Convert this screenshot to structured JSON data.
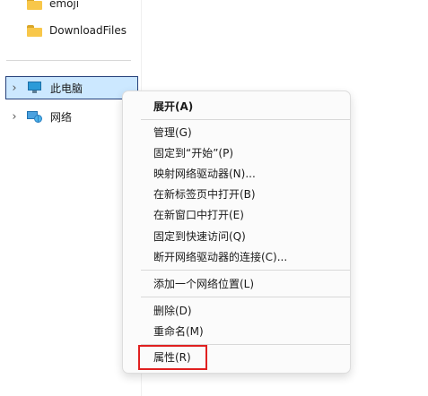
{
  "sidebar": {
    "folders": [
      {
        "label": "emoji",
        "icon": "folder-icon"
      },
      {
        "label": "DownloadFiles",
        "icon": "folder-icon"
      }
    ],
    "this_pc": {
      "label": "此电脑",
      "icon": "computer-icon",
      "expander": "›"
    },
    "network": {
      "label": "网络",
      "icon": "network-icon",
      "expander": "›"
    }
  },
  "context_menu": {
    "expand": "展开(A)",
    "manage": "管理(G)",
    "pin_start": "固定到“开始”(P)",
    "map_drive": "映射网络驱动器(N)...",
    "open_new_tab": "在新标签页中打开(B)",
    "open_new_window": "在新窗口中打开(E)",
    "pin_quick_access": "固定到快速访问(Q)",
    "disconnect_drive": "断开网络驱动器的连接(C)...",
    "add_network_location": "添加一个网络位置(L)",
    "delete": "删除(D)",
    "rename": "重命名(M)",
    "properties": "属性(R)"
  },
  "colors": {
    "selection": "#cce8ff",
    "selection_border": "#25407a",
    "highlight": "#e02020",
    "folder": "#f8c74a"
  }
}
